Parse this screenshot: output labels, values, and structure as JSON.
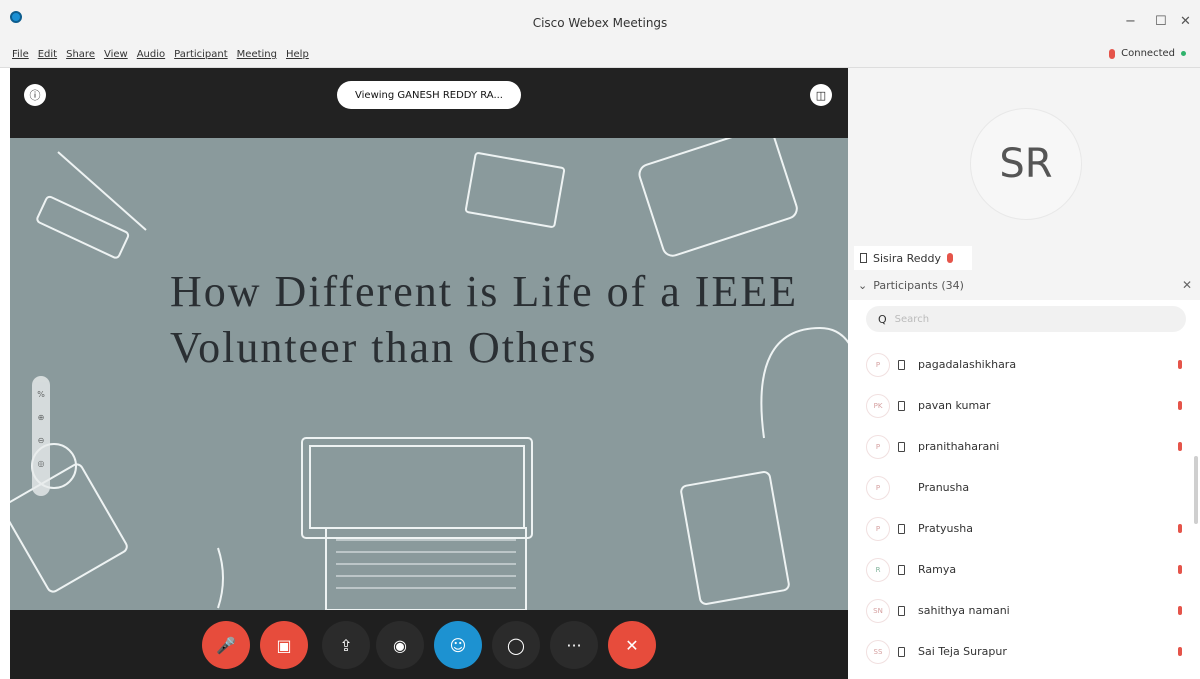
{
  "window": {
    "title": "Cisco Webex Meetings",
    "minimize": "−",
    "maximize": "☐",
    "close": "✕"
  },
  "menu": [
    "File",
    "Edit",
    "Share",
    "View",
    "Audio",
    "Participant",
    "Meeting",
    "Help"
  ],
  "status": {
    "label": "Connected"
  },
  "stage": {
    "viewing_label": "Viewing GANESH REDDY RA...",
    "slide_title_line1": "How Different is Life of a IEEE",
    "slide_title_line2": "Volunteer than Others"
  },
  "zoom": {
    "percent_label": "%"
  },
  "controls": [
    {
      "name": "mute-button",
      "icon": "microphone-icon",
      "color": "#e74c3c"
    },
    {
      "name": "video-button",
      "icon": "camera-icon",
      "color": "#e74c3c"
    },
    {
      "name": "share-button",
      "icon": "share-icon",
      "color": "#2b2b2b"
    },
    {
      "name": "record-button",
      "icon": "record-icon",
      "color": "#2b2b2b"
    },
    {
      "name": "participants-button",
      "icon": "person-icon",
      "color": "#1d92d1"
    },
    {
      "name": "chat-button",
      "icon": "chat-icon",
      "color": "#2b2b2b"
    },
    {
      "name": "more-button",
      "icon": "ellipsis-icon",
      "color": "#2b2b2b"
    },
    {
      "name": "leave-button",
      "icon": "close-icon",
      "color": "#e74c3c"
    }
  ],
  "sidebar": {
    "active_speaker_initials": "SR",
    "active_speaker_name": "Sisira Reddy",
    "participants_header": "Participants (34)",
    "search_placeholder": "Search",
    "participants": [
      {
        "initials": "P",
        "name": "pagadalashikhara",
        "device": true,
        "mic": true,
        "avatar_color": "#d5a0a0"
      },
      {
        "initials": "PK",
        "name": "pavan kumar",
        "device": true,
        "mic": true,
        "avatar_color": "#d5a0a0"
      },
      {
        "initials": "P",
        "name": "pranithaharani",
        "device": true,
        "mic": true,
        "avatar_color": "#d5a0a0"
      },
      {
        "initials": "P",
        "name": "Pranusha",
        "device": false,
        "mic": false,
        "avatar_color": "#d5a0a0"
      },
      {
        "initials": "P",
        "name": "Pratyusha",
        "device": true,
        "mic": true,
        "avatar_color": "#d5a0a0"
      },
      {
        "initials": "R",
        "name": "Ramya",
        "device": true,
        "mic": true,
        "avatar_color": "#80b39b"
      },
      {
        "initials": "SN",
        "name": "sahithya namani",
        "device": true,
        "mic": true,
        "avatar_color": "#d5a0a0"
      },
      {
        "initials": "SS",
        "name": "Sai Teja Surapur",
        "device": true,
        "mic": true,
        "avatar_color": "#d5a0a0"
      }
    ]
  }
}
